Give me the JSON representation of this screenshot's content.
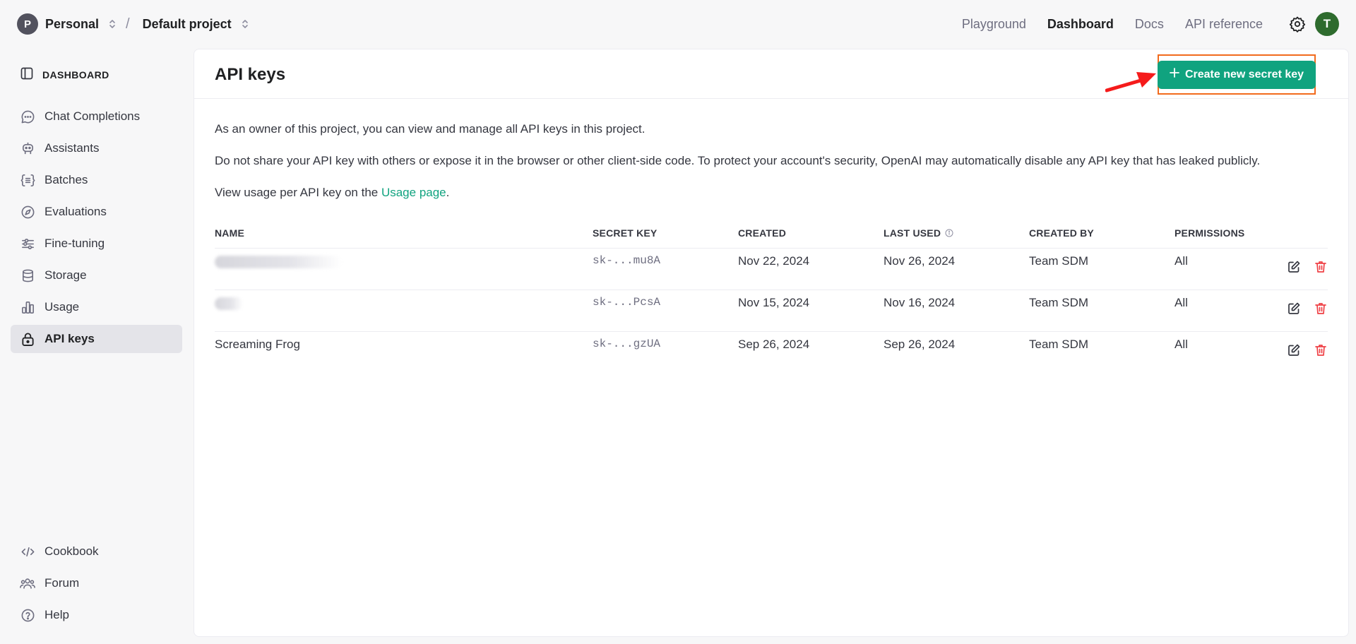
{
  "topbar": {
    "org_initial": "P",
    "org_name": "Personal",
    "project_name": "Default project",
    "nav": [
      "Playground",
      "Dashboard",
      "Docs",
      "API reference"
    ],
    "active_nav": "Dashboard",
    "user_initial": "T"
  },
  "sidebar": {
    "header": "DASHBOARD",
    "items": [
      {
        "label": "Chat Completions",
        "icon": "chat-icon"
      },
      {
        "label": "Assistants",
        "icon": "robot-icon"
      },
      {
        "label": "Batches",
        "icon": "braces-list-icon"
      },
      {
        "label": "Evaluations",
        "icon": "compass-icon"
      },
      {
        "label": "Fine-tuning",
        "icon": "sliders-icon"
      },
      {
        "label": "Storage",
        "icon": "database-icon"
      },
      {
        "label": "Usage",
        "icon": "bar-chart-icon"
      },
      {
        "label": "API keys",
        "icon": "lock-icon",
        "active": true
      }
    ],
    "bottom_items": [
      {
        "label": "Cookbook",
        "icon": "code-icon"
      },
      {
        "label": "Forum",
        "icon": "people-icon"
      },
      {
        "label": "Help",
        "icon": "help-icon"
      }
    ]
  },
  "main": {
    "title": "API keys",
    "create_button": "Create new secret key",
    "intro_1": "As an owner of this project, you can view and manage all API keys in this project.",
    "intro_2": "Do not share your API key with others or expose it in the browser or other client-side code. To protect your account's security, OpenAI may automatically disable any API key that has leaked publicly.",
    "usage_prefix": "View usage per API key on the ",
    "usage_link": "Usage page",
    "usage_suffix": ".",
    "columns": [
      "NAME",
      "SECRET KEY",
      "CREATED",
      "LAST USED",
      "CREATED BY",
      "PERMISSIONS"
    ],
    "rows": [
      {
        "name": "",
        "name_redacted": true,
        "key": "sk-...mu8A",
        "created": "Nov 22, 2024",
        "last_used": "Nov 26, 2024",
        "created_by": "Team SDM",
        "permissions": "All"
      },
      {
        "name": "",
        "name_redacted": true,
        "key": "sk-...PcsA",
        "created": "Nov 15, 2024",
        "last_used": "Nov 16, 2024",
        "created_by": "Team SDM",
        "permissions": "All"
      },
      {
        "name": "Screaming Frog",
        "name_redacted": false,
        "key": "sk-...gzUA",
        "created": "Sep 26, 2024",
        "last_used": "Sep 26, 2024",
        "created_by": "Team SDM",
        "permissions": "All"
      }
    ]
  },
  "colors": {
    "accent": "#10a37f",
    "delete": "#ef4146",
    "highlight": "#f26b1d",
    "annotation_arrow": "#f51b1b"
  }
}
